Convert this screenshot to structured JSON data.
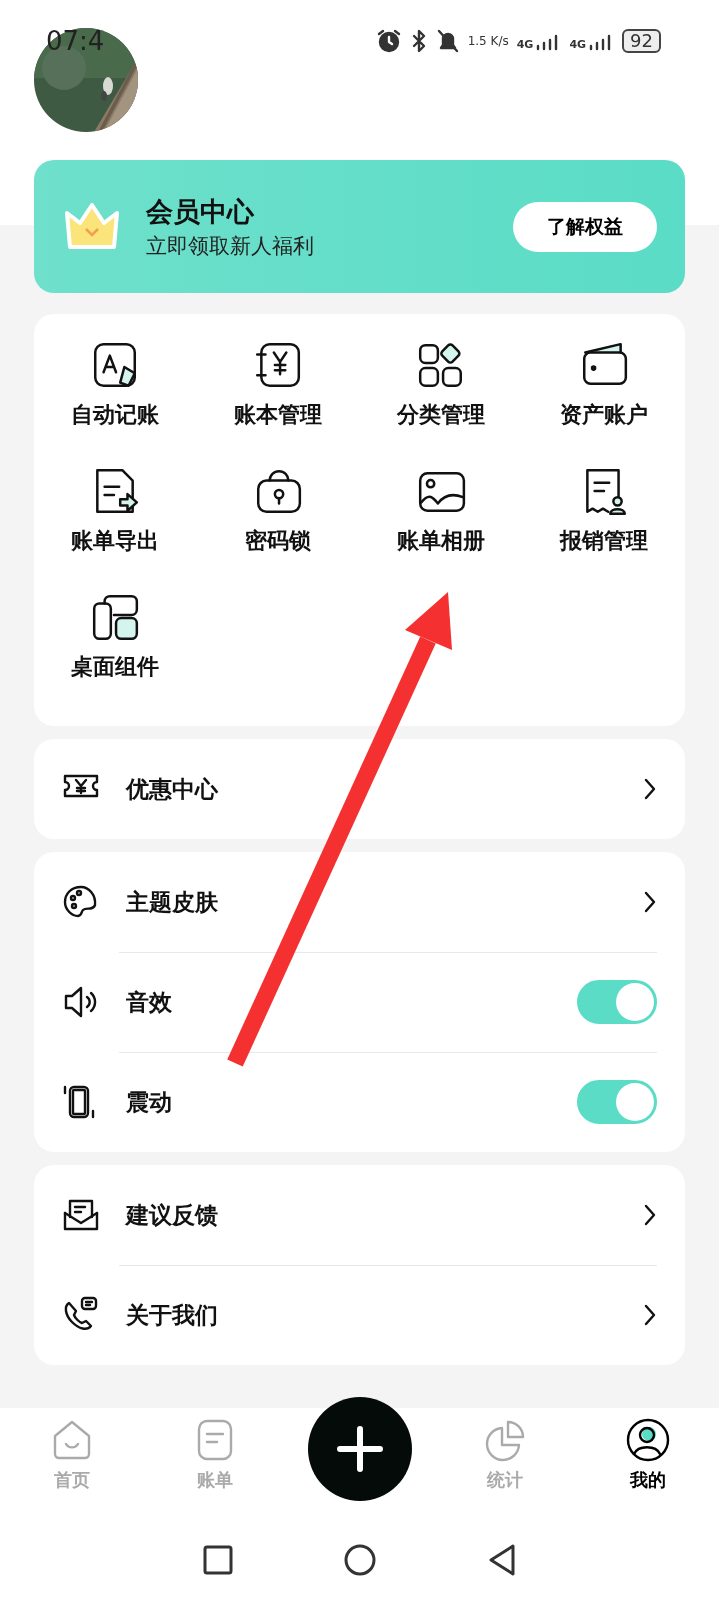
{
  "status_bar": {
    "time": "07:4",
    "net_speed": "1.5 K/s",
    "sim_1": "4G",
    "sim_2": "4G",
    "battery": "92"
  },
  "member_card": {
    "title": "会员中心",
    "subtitle": "立即领取新人福利",
    "button": "了解权益"
  },
  "features": [
    {
      "label": "自动记账"
    },
    {
      "label": "账本管理"
    },
    {
      "label": "分类管理"
    },
    {
      "label": "资产账户"
    },
    {
      "label": "账单导出"
    },
    {
      "label": "密码锁"
    },
    {
      "label": "账单相册"
    },
    {
      "label": "报销管理"
    },
    {
      "label": "桌面组件"
    }
  ],
  "menu_groups": [
    [
      {
        "kind": "link",
        "label": "优惠中心"
      }
    ],
    [
      {
        "kind": "link",
        "label": "主题皮肤"
      },
      {
        "kind": "toggle",
        "label": "音效",
        "on": true
      },
      {
        "kind": "toggle",
        "label": "震动",
        "on": true
      }
    ],
    [
      {
        "kind": "link",
        "label": "建议反馈"
      },
      {
        "kind": "link",
        "label": "关于我们"
      }
    ]
  ],
  "bottom_nav": [
    {
      "kind": "tab",
      "label": "首页",
      "selected": false
    },
    {
      "kind": "tab",
      "label": "账单",
      "selected": false
    },
    {
      "kind": "add"
    },
    {
      "kind": "tab",
      "label": "统计",
      "selected": false
    },
    {
      "kind": "tab",
      "label": "我的",
      "selected": true
    }
  ]
}
